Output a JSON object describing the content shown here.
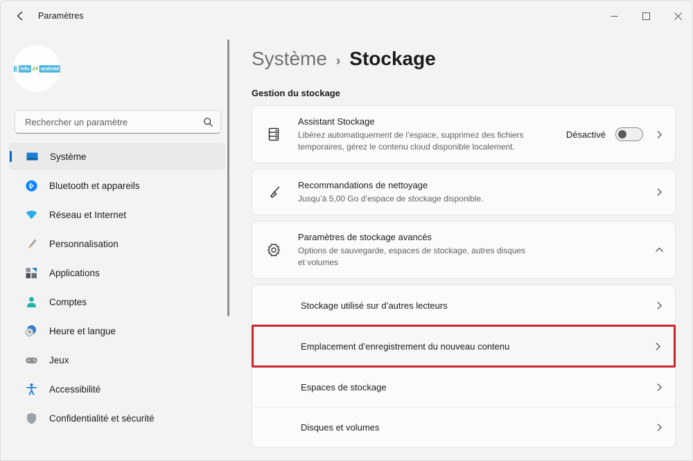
{
  "window": {
    "title": "Paramètres",
    "back_icon": "back-arrow-icon",
    "controls": {
      "minimize": "–",
      "maximize": "□",
      "close": "✕"
    }
  },
  "sidebar": {
    "avatar": {
      "logo_info": "info",
      "logo_num": "24",
      "logo_android": "android"
    },
    "search": {
      "placeholder": "Rechercher un paramètre",
      "value": "",
      "icon": "search-icon"
    },
    "items": [
      {
        "label": "Système",
        "icon": "monitor-icon",
        "selected": true
      },
      {
        "label": "Bluetooth et appareils",
        "icon": "bluetooth-icon",
        "selected": false
      },
      {
        "label": "Réseau et Internet",
        "icon": "wifi-icon",
        "selected": false
      },
      {
        "label": "Personnalisation",
        "icon": "brush-icon",
        "selected": false
      },
      {
        "label": "Applications",
        "icon": "apps-icon",
        "selected": false
      },
      {
        "label": "Comptes",
        "icon": "person-icon",
        "selected": false
      },
      {
        "label": "Heure et langue",
        "icon": "clock-globe-icon",
        "selected": false
      },
      {
        "label": "Jeux",
        "icon": "gamepad-icon",
        "selected": false
      },
      {
        "label": "Accessibilité",
        "icon": "accessibility-icon",
        "selected": false
      },
      {
        "label": "Confidentialité et sécurité",
        "icon": "shield-icon",
        "selected": false
      }
    ]
  },
  "main": {
    "breadcrumb": {
      "parent": "Système",
      "separator": "›",
      "current": "Stockage"
    },
    "section_title": "Gestion du stockage",
    "cards": [
      {
        "title": "Assistant Stockage",
        "desc": "Libérez automatiquement de l’espace, supprimez des fichiers temporaires, gérez le contenu cloud disponible localement.",
        "icon": "storage-rack-icon",
        "toggle_label": "Désactivé",
        "toggle_state": "off",
        "chevron": "chevron-right-icon"
      },
      {
        "title": "Recommandations de nettoyage",
        "desc": "Jusqu’à 5,00 Go d’espace de stockage disponible.",
        "icon": "broom-icon",
        "chevron": "chevron-right-icon"
      },
      {
        "title": "Paramètres de stockage avancés",
        "desc": "Options de sauvegarde, espaces de stockage, autres disques et volumes",
        "icon": "gear-icon",
        "chevron": "chevron-up-icon",
        "expanded": true
      }
    ],
    "sub_items": [
      {
        "label": "Stockage utilisé sur d’autres lecteurs",
        "chevron": "chevron-right-icon",
        "highlighted": false
      },
      {
        "label": "Emplacement d’enregistrement du nouveau contenu",
        "chevron": "chevron-right-icon",
        "highlighted": true
      },
      {
        "label": "Espaces de stockage",
        "chevron": "chevron-right-icon",
        "highlighted": false
      },
      {
        "label": "Disques et volumes",
        "chevron": "chevron-right-icon",
        "highlighted": false
      }
    ]
  },
  "colors": {
    "accent": "#0067c0",
    "highlight": "#c9252d",
    "page_bg": "#f3f3f3",
    "card_bg": "#fbfbfb"
  }
}
